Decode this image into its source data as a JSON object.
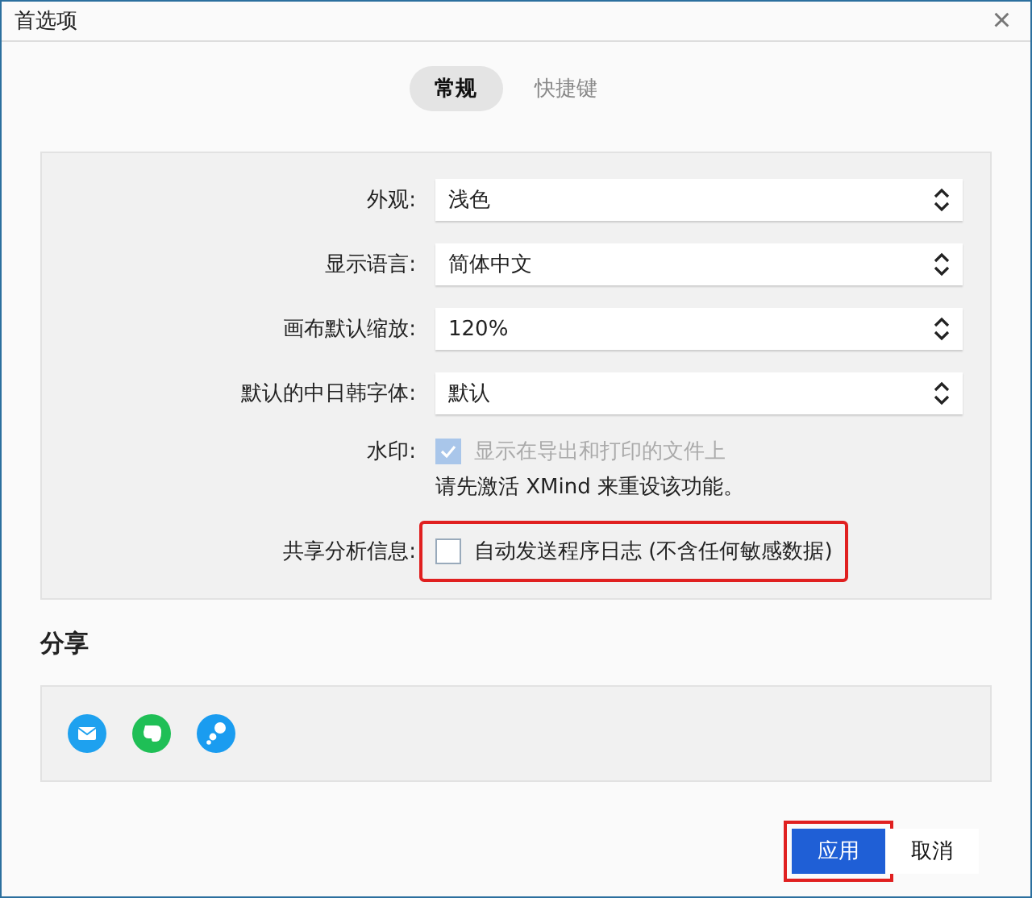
{
  "window": {
    "title": "首选项",
    "close": "×"
  },
  "tabs": [
    {
      "label": "常规",
      "selected": true
    },
    {
      "label": "快捷键",
      "selected": false
    }
  ],
  "settings": [
    {
      "label": "外观:",
      "value": "浅色"
    },
    {
      "label": "显示语言:",
      "value": "简体中文"
    },
    {
      "label": "画布默认缩放:",
      "value": "120%"
    },
    {
      "label": "默认的中日韩字体:",
      "value": "默认"
    }
  ],
  "watermark": {
    "label": "水印:",
    "option": "显示在导出和打印的文件上",
    "checked": true,
    "disabled": true,
    "note": "请先激活 XMind 来重设该功能。"
  },
  "analytics": {
    "label": "共享分析信息:",
    "option": "自动发送程序日志 (不含任何敏感数据)",
    "checked": false,
    "highlighted": true
  },
  "share": {
    "heading": "分享",
    "services": [
      {
        "kind": "mail",
        "color": "#1ea1ef"
      },
      {
        "kind": "evernote",
        "color": "#1fbf56"
      },
      {
        "kind": "bubbles",
        "color": "#1a9cf0"
      }
    ]
  },
  "buttons": [
    {
      "label": "应用",
      "primary": true,
      "highlighted": true
    },
    {
      "label": "取消",
      "primary": false,
      "highlighted": false
    }
  ]
}
